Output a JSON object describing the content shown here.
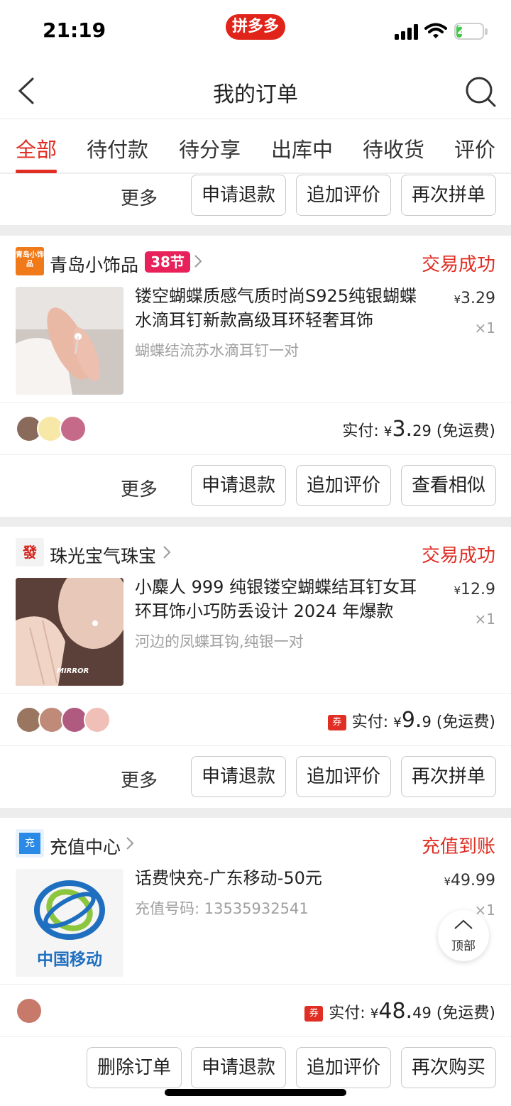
{
  "status": {
    "time": "21:19",
    "battery": "22",
    "battery_level": 0.22,
    "app_logo_text": "拼多多"
  },
  "nav": {
    "title": "我的订单"
  },
  "tabs": [
    {
      "label": "全部",
      "active": true
    },
    {
      "label": "待付款"
    },
    {
      "label": "待分享"
    },
    {
      "label": "出库中"
    },
    {
      "label": "待收货"
    },
    {
      "label": "评价"
    }
  ],
  "colors": {
    "accent": "#e02e24",
    "badge": "#e8215a"
  },
  "top_partial": {
    "more": "更多",
    "buttons": [
      "申请退款",
      "追加评价",
      "再次拼单"
    ]
  },
  "orders": [
    {
      "shop": "青岛小饰品",
      "shop_icon_text": "青岛小饰品",
      "badge": "38节",
      "status": "交易成功",
      "title": "镂空蝴蝶质感气质时尚S925纯银蝴蝶水滴耳钉新款高级耳环轻奢耳饰",
      "spec": "蝴蝶结流苏水滴耳钉一对",
      "price_symbol": "¥",
      "price_int": "3.",
      "price_dec": "29",
      "qty": "×1",
      "paid_label": "实付:",
      "paid_symbol": "¥",
      "paid_int": "3.",
      "paid_dec": "29",
      "shipping": "(免运费)",
      "more": "更多",
      "buttons": [
        "申请退款",
        "追加评价",
        "查看相似"
      ]
    },
    {
      "shop": "珠光宝气珠宝",
      "shop_icon_text": "發",
      "status": "交易成功",
      "title": "小麋人 999 纯银镂空蝴蝶结耳钉女耳环耳饰小巧防丢设计 2024 年爆款",
      "spec": "河边的凤蝶耳钩,纯银一对",
      "thumb_text": "MIRROR",
      "price_symbol": "¥",
      "price_int": "12.",
      "price_dec": "9",
      "qty": "×1",
      "coupon": "券",
      "paid_label": "实付:",
      "paid_symbol": "¥",
      "paid_int": "9.",
      "paid_dec": "9",
      "shipping": "(免运费)",
      "more": "更多",
      "buttons": [
        "申请退款",
        "追加评价",
        "再次拼单"
      ]
    },
    {
      "shop": "充值中心",
      "shop_icon_text": "充",
      "status": "充值到账",
      "title": "话费快充-广东移动-50元",
      "spec": "充值号码: 13535932541",
      "thumb_text": "中国移动",
      "price_symbol": "¥",
      "price_int": "49.",
      "price_dec": "99",
      "qty": "×1",
      "coupon": "券",
      "paid_label": "实付:",
      "paid_symbol": "¥",
      "paid_int": "48.",
      "paid_dec": "49",
      "shipping": "(免运费)",
      "buttons": [
        "删除订单",
        "申请退款",
        "追加评价",
        "再次购买"
      ]
    }
  ],
  "to_top": "顶部"
}
